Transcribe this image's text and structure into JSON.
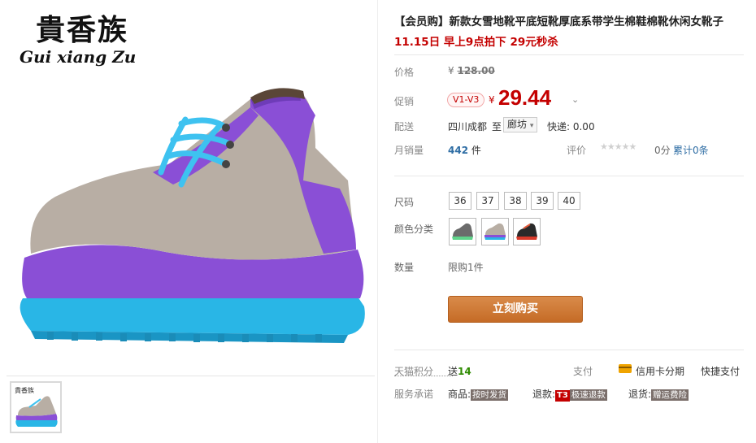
{
  "brand": {
    "name_cn": "貴香族",
    "name_en": "Gui xiang Zu"
  },
  "product": {
    "title": "【会员购】新款女雪地靴平底短靴厚底系带学生棉鞋棉靴休闲女靴子",
    "promo": "11.15日 早上9点拍下 29元秒杀"
  },
  "price": {
    "label": "价格",
    "currency": "¥",
    "original": "128.00",
    "promo_label": "促销",
    "vip_tag": "V1-V3",
    "promo_price": "29.44"
  },
  "delivery": {
    "label": "配送",
    "origin": "四川成都",
    "to": "至",
    "destination": "廊坊",
    "express": "快递: 0.00"
  },
  "sales": {
    "label": "月销量",
    "count": "442",
    "unit": "件",
    "rating_label": "评价",
    "score": "0分",
    "total": "累计0条"
  },
  "sizes": {
    "label": "尺码",
    "options": [
      "36",
      "37",
      "38",
      "39",
      "40"
    ]
  },
  "colors": {
    "label": "颜色分类",
    "options": [
      "green-grey",
      "purple-grey",
      "red-black"
    ]
  },
  "quantity": {
    "label": "数量",
    "limit": "限购1件"
  },
  "buy_button": "立刻购买",
  "points": {
    "label": "天猫积分",
    "value_prefix": "送",
    "value": "14"
  },
  "payment": {
    "label": "支付",
    "installment": "信用卡分期",
    "quick": "快捷支付"
  },
  "service": {
    "label": "服务承诺",
    "goods": "商品:",
    "goods_tag": "按时发货",
    "refund": "退款:",
    "refund_t3": "T3",
    "refund_tag": "极速退款",
    "return": "退货:",
    "return_tag": "赠运费险"
  },
  "colors_theme": {
    "accent_red": "#c40000",
    "buy_button": "#c9722f",
    "points_green": "#2e8b00"
  }
}
